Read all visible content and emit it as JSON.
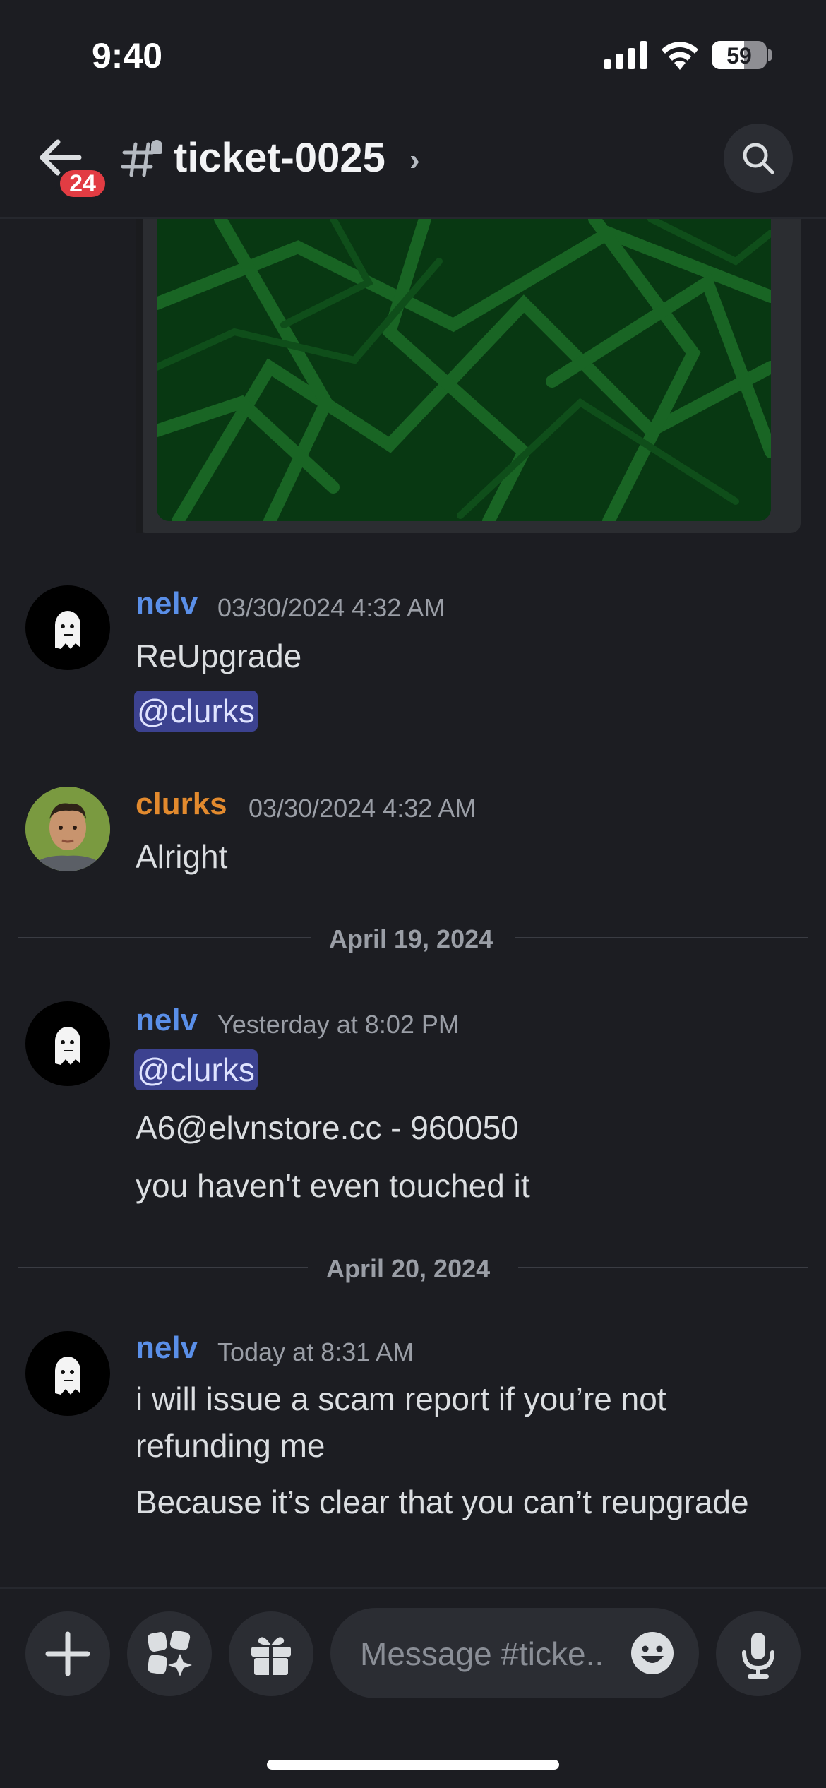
{
  "status_bar": {
    "time": "9:40",
    "battery": "59"
  },
  "header": {
    "back_badge": "24",
    "channel_name": "ticket-0025",
    "chevron": "›"
  },
  "messages": [
    {
      "author": "nelv",
      "timestamp": "03/30/2024 4:32 AM",
      "lines": [
        "ReUpgrade"
      ],
      "mention": "@clurks"
    },
    {
      "author": "clurks",
      "timestamp": "03/30/2024 4:32 AM",
      "lines": [
        "Alright"
      ]
    },
    {
      "divider": "April 19, 2024"
    },
    {
      "author": "nelv",
      "timestamp": "Yesterday at 8:02 PM",
      "mention": "@clurks",
      "lines": [
        "A6@elvnstore.cc - 960050",
        "you haven't even touched it"
      ]
    },
    {
      "divider": "April 20, 2024"
    },
    {
      "author": "nelv",
      "timestamp": "Today at 8:31 AM",
      "lines": [
        "i will issue a scam report if you’re not",
        "refunding me",
        "Because it’s clear that you can’t reupgrade"
      ]
    }
  ],
  "composer": {
    "placeholder": "Message #ticke.."
  },
  "colors": {
    "background": "#1c1d22",
    "nelv": "#5a8fe8",
    "clurks": "#e28a2e",
    "mention_bg": "#3c4290",
    "badge": "#e23c43"
  },
  "icons": [
    "signal-icon",
    "wifi-icon",
    "battery-icon",
    "back-arrow-icon",
    "thread-channel-icon",
    "search-icon",
    "plus-icon",
    "apps-icon",
    "gift-icon",
    "emoji-icon",
    "microphone-icon"
  ]
}
